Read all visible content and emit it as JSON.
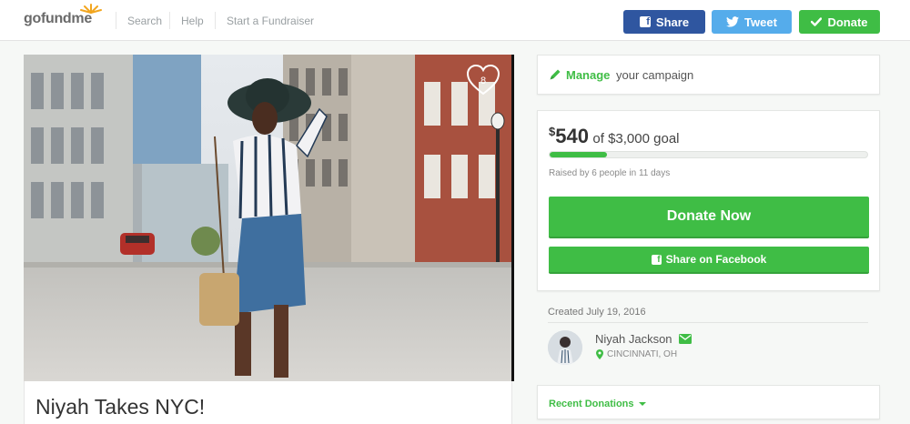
{
  "header": {
    "logo_text": "gofundme",
    "nav": [
      {
        "label": "Search"
      },
      {
        "label": "Help"
      },
      {
        "label": "Start a Fundraiser"
      }
    ],
    "buttons": {
      "share": "Share",
      "tweet": "Tweet",
      "donate": "Donate"
    }
  },
  "campaign": {
    "title": "Niyah Takes NYC!",
    "heart_count": "8"
  },
  "manage": {
    "strong": "Manage",
    "rest": "your campaign"
  },
  "funding": {
    "currency": "$",
    "raised": "540",
    "goal_text": "of $3,000 goal",
    "progress_fraction": 0.18,
    "raised_by": "Raised by 6 people in 11 days",
    "donate_now": "Donate Now",
    "share_facebook": "Share on Facebook"
  },
  "organizer": {
    "created": "Created July 19, 2016",
    "name": "Niyah Jackson",
    "location": "CINCINNATI, OH"
  },
  "recent": {
    "label": "Recent Donations"
  },
  "colors": {
    "accent_green": "#3fbd45",
    "facebook_blue": "#2f56a0",
    "twitter_blue": "#55aceb"
  }
}
